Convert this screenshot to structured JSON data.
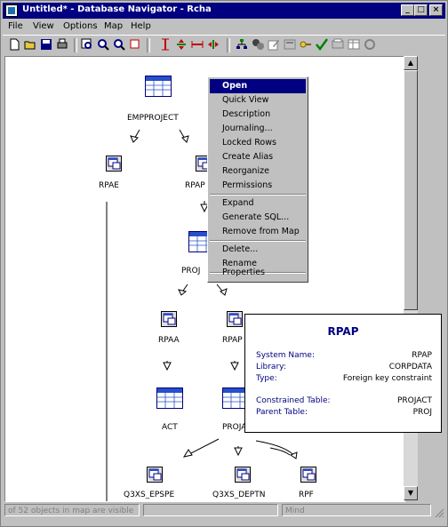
{
  "window": {
    "title": "Untitled* - Database Navigator - Rcha"
  },
  "title_buttons": {
    "minimize": "_",
    "maximize": "□",
    "close": "×"
  },
  "menu": [
    "File",
    "View",
    "Options",
    "Map",
    "Help"
  ],
  "toolbar": {
    "icons": [
      "new-icon",
      "open-folder-icon",
      "save-icon",
      "print-icon",
      "find-icon",
      "zoom-in-icon",
      "zoom-out-icon",
      "select-icon",
      "vertical-layout-icon",
      "vertical-arrows-icon",
      "horizontal-layout-icon",
      "horizontal-arrows-icon",
      "tree-icon",
      "gear-group-icon",
      "edit-icon",
      "view-icon",
      "key-icon",
      "check-icon",
      "print-map-icon",
      "table-map-icon",
      "refresh-icon"
    ]
  },
  "nodes": {
    "empproject": "EMPPROJECT",
    "rpae": "RPAE",
    "rpap_top": "RPAP",
    "proj_mid": "PROJ",
    "rpaa": "RPAA",
    "rpap_mid": "RPAP",
    "act": "ACT",
    "projact": "PROJACT",
    "bottom_left": "Q3XS_EPSPE",
    "bottom_mid": "Q3XS_DEPTN",
    "bottom_right": "RPF"
  },
  "context_menu": {
    "items": [
      "Open",
      "Quick View",
      "Description",
      "Journaling...",
      "Locked Rows",
      "Create Alias",
      "Reorganize",
      "Permissions",
      "Expand",
      "Generate SQL...",
      "Remove from Map",
      "Delete...",
      "Rename",
      "Properties"
    ],
    "selected": "Open"
  },
  "tooltip": {
    "title": "RPAP",
    "rows": [
      {
        "key": "System Name:",
        "value": "RPAP"
      },
      {
        "key": "Library:",
        "value": "CORPDATA"
      },
      {
        "key": "Type:",
        "value": "Foreign key constraint"
      },
      {
        "key": "Constrained Table:",
        "value": "PROJACT"
      },
      {
        "key": "Parent Table:",
        "value": "PROJ"
      }
    ]
  },
  "status": {
    "left": "of 52 objects in map are visible",
    "middle": "",
    "right": "Mind"
  },
  "colors": {
    "titlebar": "#000080",
    "menu_highlight": "#000080",
    "tooltip_label": "#000080",
    "table_icon_header": "#2850c8"
  }
}
